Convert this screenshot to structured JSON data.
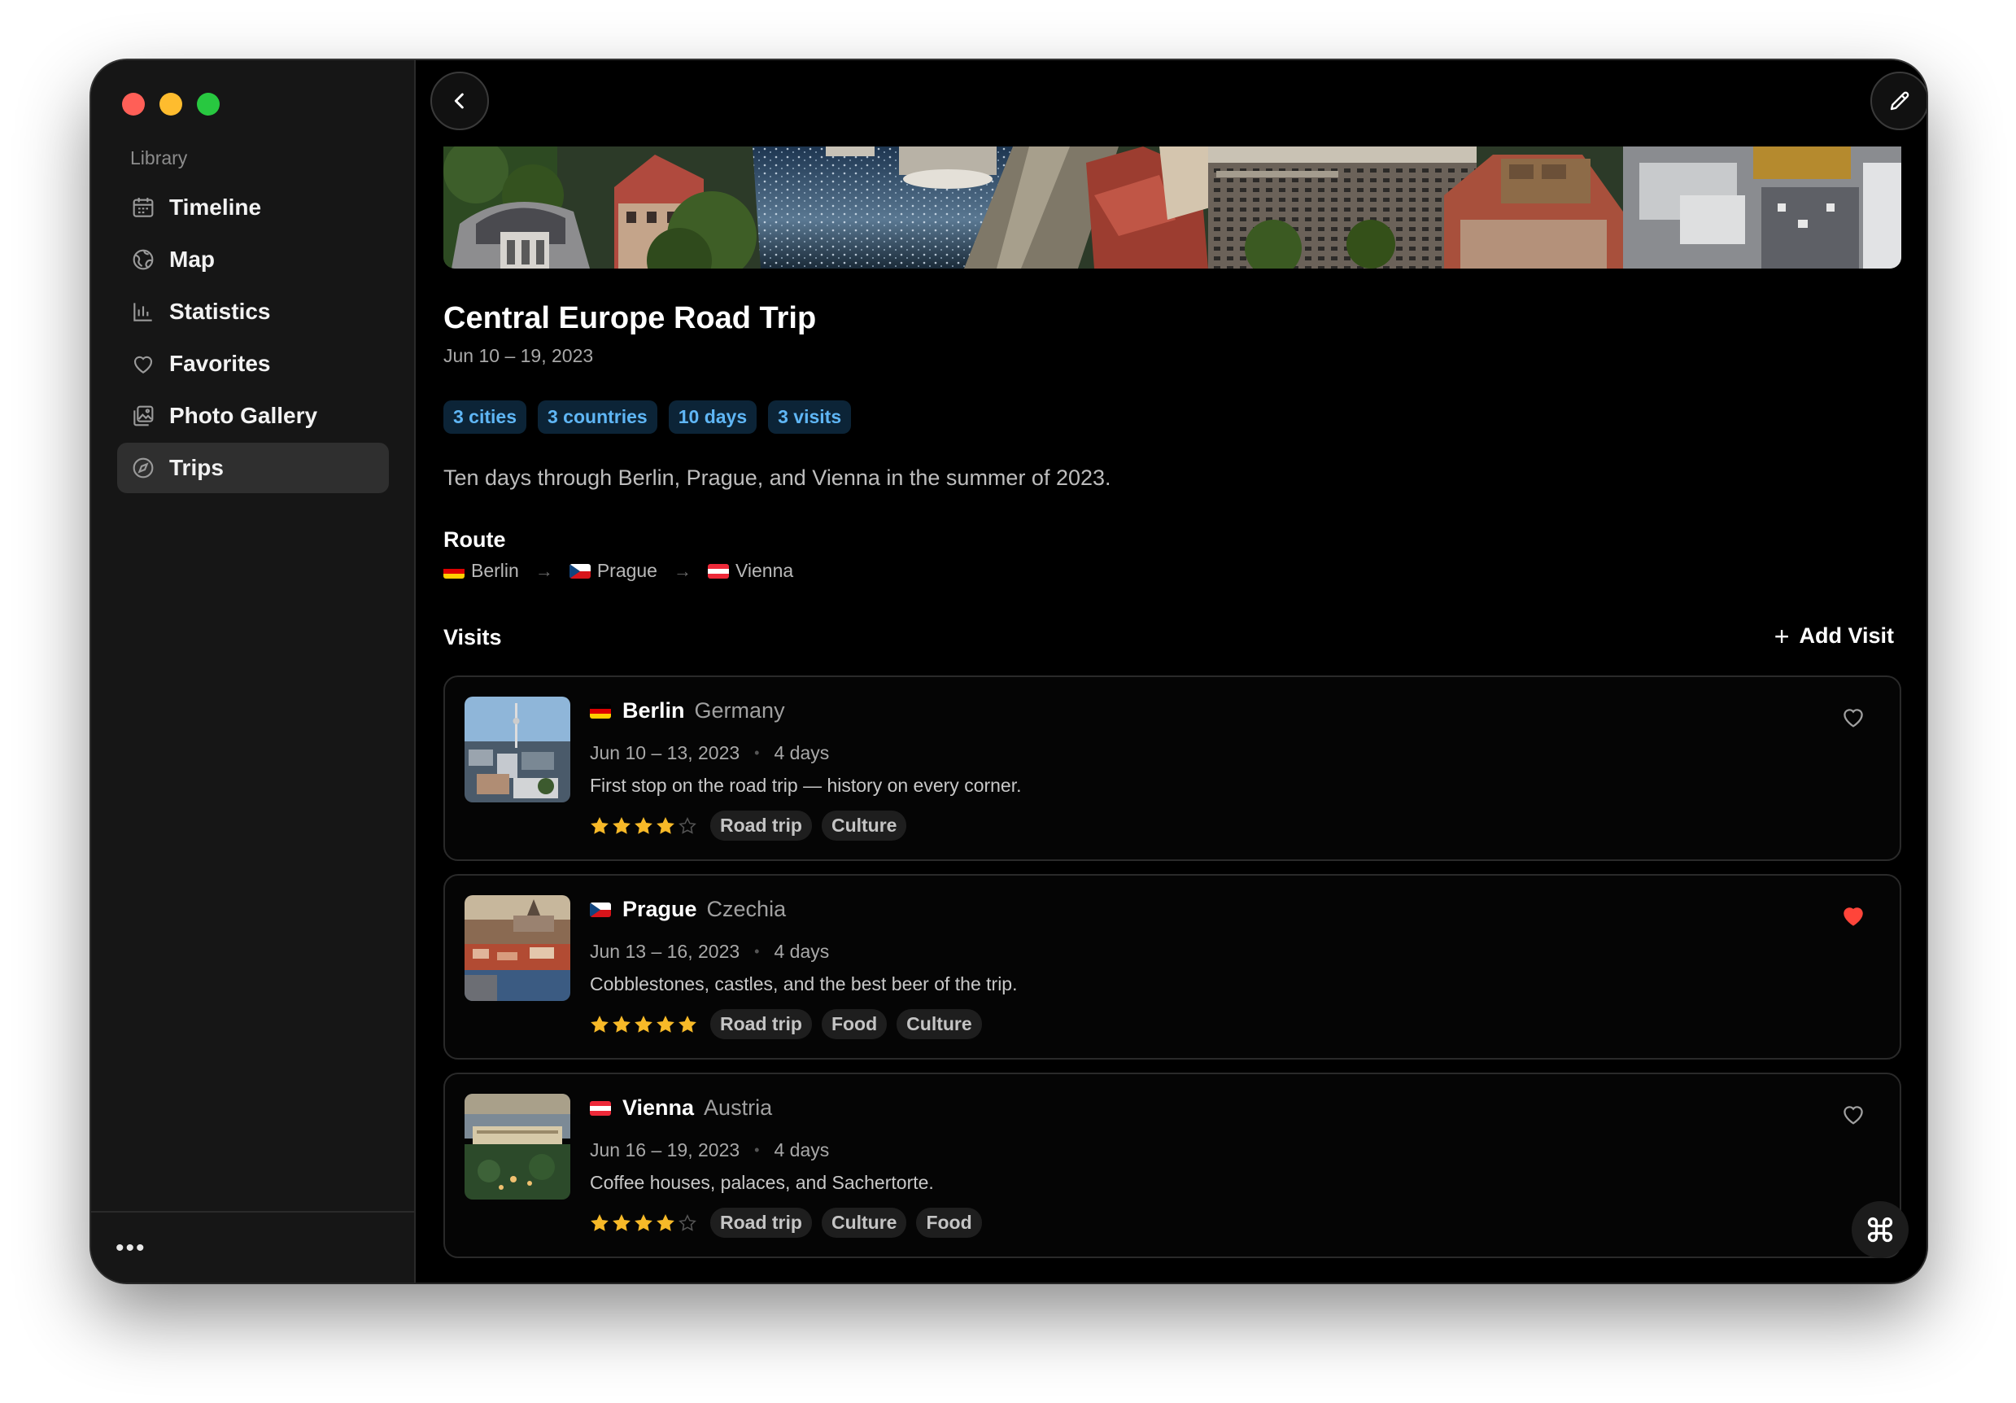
{
  "sidebar": {
    "section_label": "Library",
    "items": [
      {
        "label": "Timeline",
        "icon": "calendar-icon"
      },
      {
        "label": "Map",
        "icon": "globe-icon"
      },
      {
        "label": "Statistics",
        "icon": "bar-chart-icon"
      },
      {
        "label": "Favorites",
        "icon": "heart-icon"
      },
      {
        "label": "Photo Gallery",
        "icon": "photos-icon"
      },
      {
        "label": "Trips",
        "icon": "compass-icon",
        "active": true
      }
    ],
    "more_label": "•••"
  },
  "trip": {
    "title": "Central Europe Road Trip",
    "dates": "Jun 10 – 19, 2023",
    "chips": [
      "3 cities",
      "3 countries",
      "10 days",
      "3 visits"
    ],
    "description": "Ten days through Berlin, Prague, and Vienna in the summer of 2023.",
    "route_label": "Route",
    "route": [
      {
        "city": "Berlin",
        "flag": "de"
      },
      {
        "city": "Prague",
        "flag": "cz"
      },
      {
        "city": "Vienna",
        "flag": "at"
      }
    ]
  },
  "visits_section": {
    "label": "Visits",
    "add_label": "Add Visit"
  },
  "visits": [
    {
      "city": "Berlin",
      "country": "Germany",
      "flag": "de",
      "dates": "Jun 10 – 13, 2023",
      "duration": "4 days",
      "note": "First stop on the road trip — history on every corner.",
      "rating": 4,
      "tags": [
        "Road trip",
        "Culture"
      ],
      "favorite": false
    },
    {
      "city": "Prague",
      "country": "Czechia",
      "flag": "cz",
      "dates": "Jun 13 – 16, 2023",
      "duration": "4 days",
      "note": "Cobblestones, castles, and the best beer of the trip.",
      "rating": 5,
      "tags": [
        "Road trip",
        "Food",
        "Culture"
      ],
      "favorite": true
    },
    {
      "city": "Vienna",
      "country": "Austria",
      "flag": "at",
      "dates": "Jun 16 – 19, 2023",
      "duration": "4 days",
      "note": "Coffee houses, palaces, and Sachertorte.",
      "rating": 4,
      "tags": [
        "Road trip",
        "Culture",
        "Food"
      ],
      "favorite": false
    }
  ],
  "colors": {
    "chip_text": "#5fb6f5",
    "chip_bg": "#0c2437",
    "star": "#f7b928",
    "favorite": "#ff453a"
  }
}
